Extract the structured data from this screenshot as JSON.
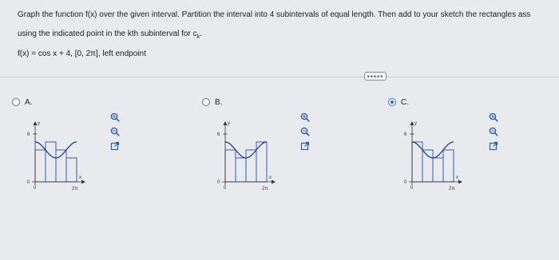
{
  "question": {
    "line1": "Graph the function f(x) over the given interval. Partition the interval into 4 subintervals of equal length. Then add to your sketch the rectangles ass",
    "line2_prefix": "using the indicated point in the kth subinterval for c",
    "line2_sub": "k",
    "line2_suffix": ".",
    "function_text": "f(x) = cos x + 4, [0, 2π], left endpoint"
  },
  "more_button_label": "•••••",
  "options": [
    {
      "label": "A.",
      "selected": false,
      "graph": {
        "y_axis_label": "y",
        "x_axis_label": "x",
        "y_tick_label": "6",
        "y_zero_label": "0",
        "x_origin_label": "0",
        "x_end_label": "2π",
        "rect_heights": [
          4,
          5,
          4,
          3
        ]
      },
      "tools": [
        "zoom-in-icon",
        "zoom-out-icon",
        "external-link-icon"
      ]
    },
    {
      "label": "B.",
      "selected": false,
      "graph": {
        "y_axis_label": "y",
        "x_axis_label": "x",
        "y_tick_label": "6",
        "y_zero_label": "0",
        "x_origin_label": "0",
        "x_end_label": "2π",
        "rect_heights": [
          4,
          3,
          4,
          5
        ]
      },
      "tools": [
        "zoom-in-icon",
        "zoom-out-icon",
        "external-link-icon"
      ]
    },
    {
      "label": "C.",
      "selected": true,
      "graph": {
        "y_axis_label": "y",
        "x_axis_label": "x",
        "y_tick_label": "6",
        "y_zero_label": "0",
        "x_origin_label": "0",
        "x_end_label": "2π",
        "rect_heights": [
          5,
          4,
          3,
          4
        ]
      },
      "tools": [
        "zoom-in-icon",
        "zoom-out-icon",
        "external-link-icon"
      ]
    }
  ],
  "colors": {
    "curve": "#1f3d8f",
    "rect": "#2e5fb0",
    "radio_selected": "#2a6fd6",
    "tool_icon": "#2a5ea8"
  }
}
